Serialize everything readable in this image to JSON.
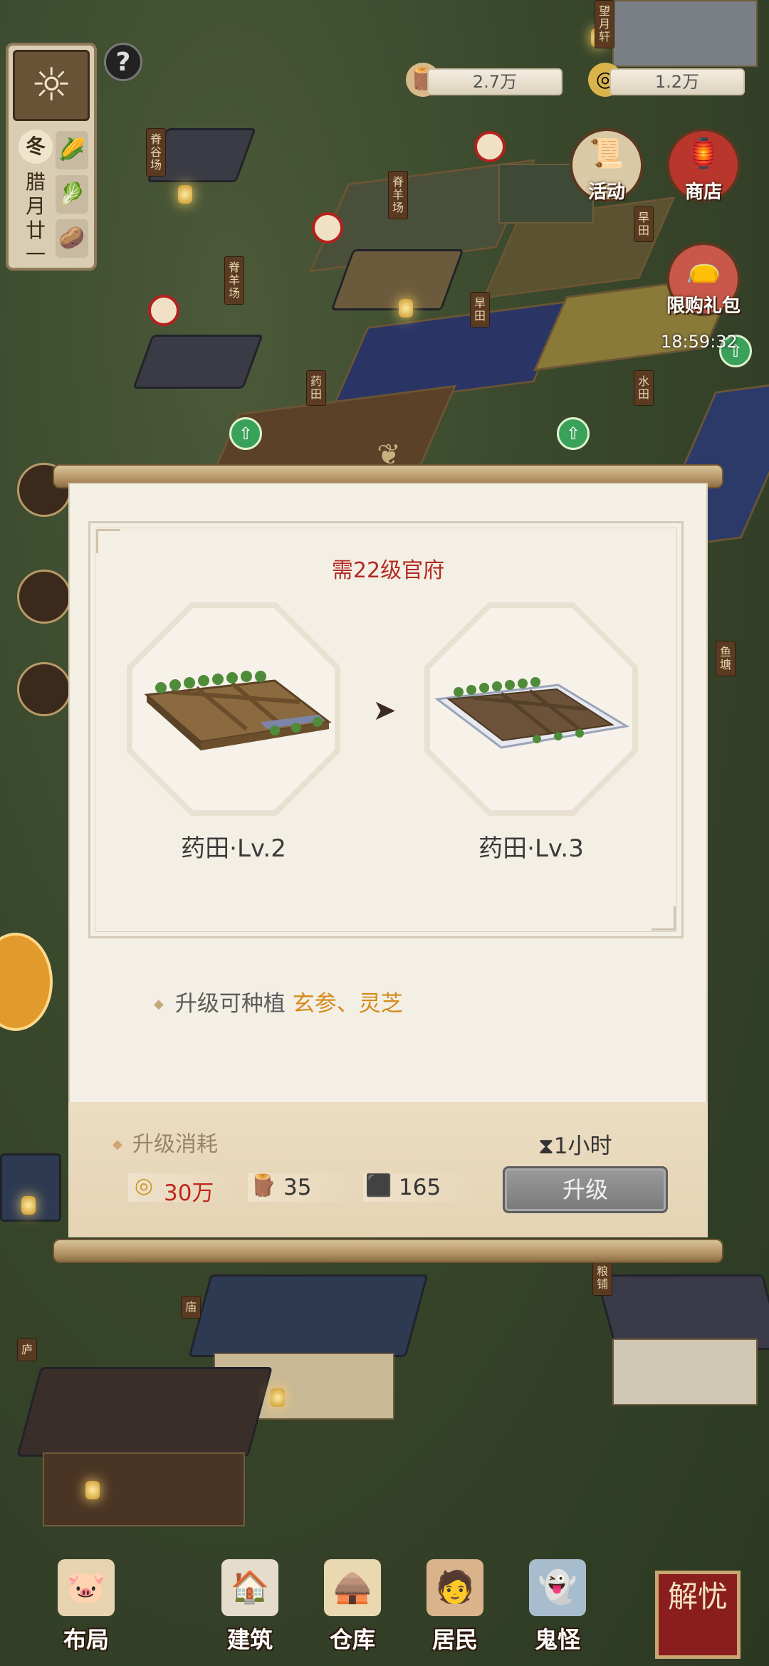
{
  "resources": {
    "wood": "2.7万",
    "coins": "1.2万"
  },
  "calendar": {
    "season": "冬",
    "date": "腊月廿一"
  },
  "top_buttons": {
    "activity": "活动",
    "shop": "商店",
    "limited_gift": "限购礼包",
    "limited_gift_timer": "18:59:32"
  },
  "map_signs": [
    "脊谷场",
    "脊羊场",
    "脊羊场",
    "药田",
    "旱田",
    "旱田",
    "水田",
    "望月轩",
    "鱼塘",
    "粮铺",
    "庙",
    "庐"
  ],
  "dialog": {
    "requirement": "需22级官府",
    "current": {
      "name": "药田·Lv.2"
    },
    "next": {
      "name": "药田·Lv.3"
    },
    "desc_prefix": "升级可种植",
    "desc_highlight": "玄参、灵芝",
    "cost_title": "升级消耗",
    "duration": "1小时",
    "costs": [
      {
        "icon": "coin-icon",
        "value": "30万",
        "color": "#c0271d"
      },
      {
        "icon": "wood-icon",
        "value": "35",
        "color": "#333333"
      },
      {
        "icon": "stone-icon",
        "value": "165",
        "color": "#333333"
      }
    ],
    "upgrade_button": "升级"
  },
  "nav": {
    "layout": "布局",
    "build": "建筑",
    "warehouse": "仓库",
    "residents": "居民",
    "ghost": "鬼怪",
    "seal": "解忧"
  }
}
